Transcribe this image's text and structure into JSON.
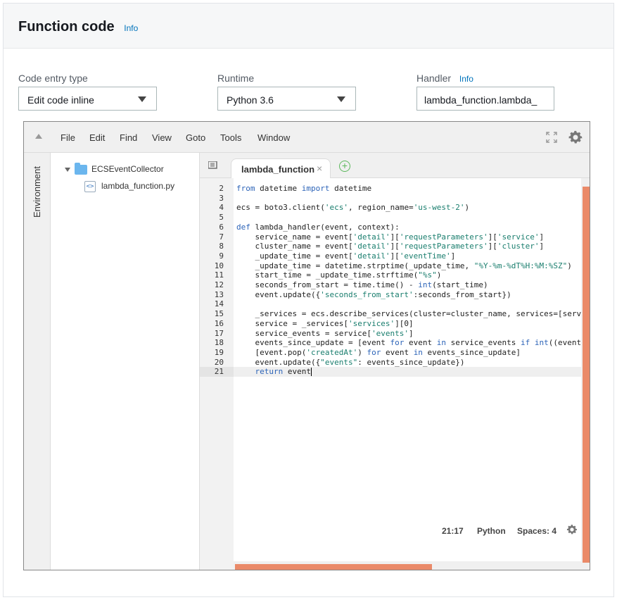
{
  "panel": {
    "title": "Function code",
    "info": "Info"
  },
  "fields": {
    "code_entry": {
      "label": "Code entry type",
      "value": "Edit code inline"
    },
    "runtime": {
      "label": "Runtime",
      "value": "Python 3.6"
    },
    "handler": {
      "label": "Handler",
      "info": "Info",
      "value": "lambda_function.lambda_"
    }
  },
  "ide": {
    "menu": [
      "File",
      "Edit",
      "Find",
      "View",
      "Goto",
      "Tools",
      "Window"
    ],
    "environment_tab": "Environment",
    "tree": {
      "folder": "ECSEventCollector",
      "file": "lambda_function.py",
      "file_icon_glyph": "<>"
    },
    "tab": {
      "label": "lambda_function",
      "close": "×",
      "add": "+"
    },
    "status": {
      "position": "21:17",
      "language": "Python",
      "spaces": "Spaces: 4"
    },
    "colors": {
      "accent_scroll": "#ea8a69",
      "keyword": "#2d64b8",
      "string": "#1a7e6e",
      "info_link": "#0073bb"
    },
    "active_line": 21,
    "code": [
      {
        "n": "2",
        "text": "from datetime import datetime"
      },
      {
        "n": "3",
        "text": ""
      },
      {
        "n": "4",
        "text": "ecs = boto3.client('ecs', region_name='us-west-2')"
      },
      {
        "n": "5",
        "text": ""
      },
      {
        "n": "6",
        "text": "def lambda_handler(event, context):"
      },
      {
        "n": "7",
        "text": "    service_name = event['detail']['requestParameters']['service']"
      },
      {
        "n": "8",
        "text": "    cluster_name = event['detail']['requestParameters']['cluster']"
      },
      {
        "n": "9",
        "text": "    _update_time = event['detail']['eventTime']"
      },
      {
        "n": "10",
        "text": "    _update_time = datetime.strptime(_update_time, \"%Y-%m-%dT%H:%M:%SZ\")"
      },
      {
        "n": "11",
        "text": "    start_time = _update_time.strftime(\"%s\")"
      },
      {
        "n": "12",
        "text": "    seconds_from_start = time.time() - int(start_time)"
      },
      {
        "n": "13",
        "text": "    event.update({'seconds_from_start':seconds_from_start})"
      },
      {
        "n": "14",
        "text": ""
      },
      {
        "n": "15",
        "text": "    _services = ecs.describe_services(cluster=cluster_name, services=[service_"
      },
      {
        "n": "16",
        "text": "    service = _services['services'][0]"
      },
      {
        "n": "17",
        "text": "    service_events = service['events']"
      },
      {
        "n": "18",
        "text": "    events_since_update = [event for event in service_events if int((event['cr"
      },
      {
        "n": "19",
        "text": "    [event.pop('createdAt') for event in events_since_update]"
      },
      {
        "n": "20",
        "text": "    event.update({\"events\": events_since_update})"
      },
      {
        "n": "21",
        "text": "    return event"
      }
    ]
  }
}
